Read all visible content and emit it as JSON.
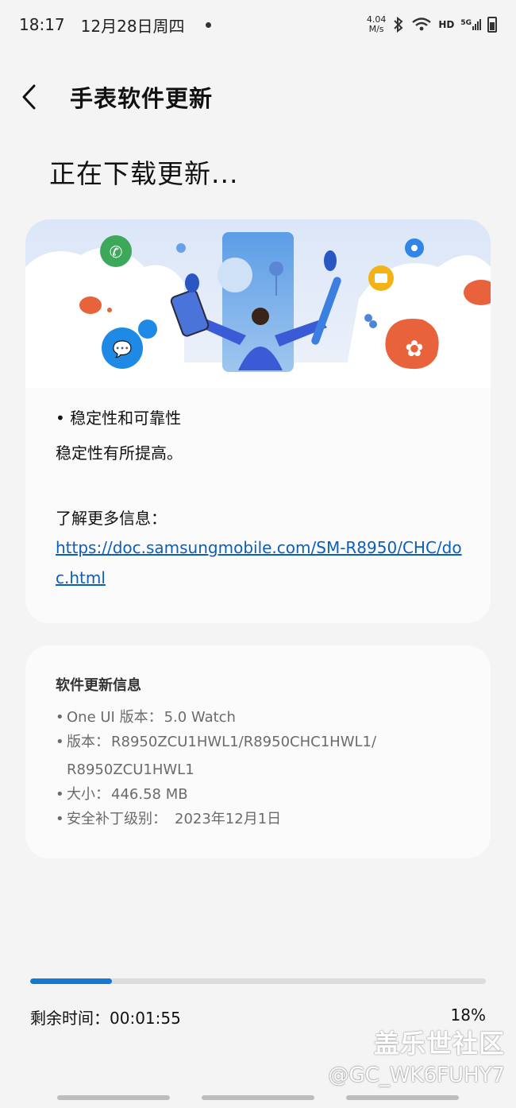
{
  "status_bar": {
    "time": "18:17",
    "date": "12月28日周四",
    "net_speed_value": "4.04",
    "net_speed_unit": "M/s",
    "hd": "HD",
    "signal": "5G"
  },
  "header": {
    "back_icon": "back-arrow-icon",
    "title": "手表软件更新"
  },
  "page": {
    "status_heading": "正在下载更新..."
  },
  "release_notes": {
    "bullet": "• 稳定性和可靠性",
    "description": "稳定性有所提高。",
    "more_info_label": "了解更多信息：",
    "link": "https://doc.samsungmobile.com/SM-R8950/CHC/doc.html"
  },
  "software_info": {
    "title": "软件更新信息",
    "one_ui_key": "One UI 版本：",
    "one_ui_value": "5.0 Watch",
    "version_key": "版本：",
    "version_value": "R8950ZCU1HWL1/R8950CHC1HWL1/",
    "version_value_cont": "R8950ZCU1HWL1",
    "size_key": "大小：",
    "size_value": "446.58 MB",
    "security_key": "安全补丁级别：",
    "security_value": "2023年12月1日"
  },
  "download": {
    "progress": 0.18,
    "remaining_label": "剩余时间：",
    "remaining_value": "00:01:55",
    "percent": "18%"
  },
  "watermark": {
    "line1": "盖乐世社区",
    "line2": "@GC_WK6FUHY7"
  },
  "colors": {
    "accent": "#1479d0",
    "link": "#0c5fb8",
    "background": "#f4f4f4",
    "card": "#fbfbfb"
  }
}
